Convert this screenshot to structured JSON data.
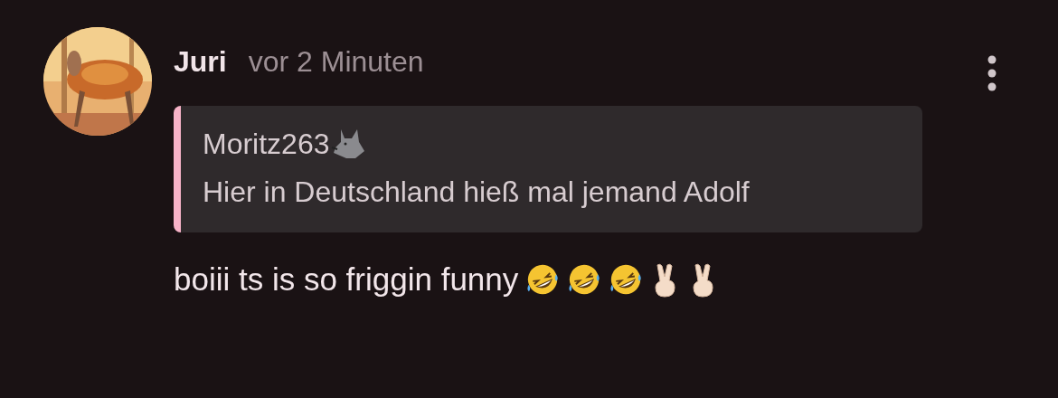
{
  "comment": {
    "author": "Juri",
    "time": "vor 2 Minuten",
    "quote": {
      "author": "Moritz263",
      "author_emoji": {
        "kind": "wolf"
      },
      "text": "Hier in Deutschland hieß mal jemand Adolf"
    },
    "text": "boiii ts is so friggin funny",
    "emojis": [
      {
        "kind": "rofl"
      },
      {
        "kind": "rofl"
      },
      {
        "kind": "rofl"
      },
      {
        "kind": "peace"
      },
      {
        "kind": "peace"
      }
    ]
  }
}
